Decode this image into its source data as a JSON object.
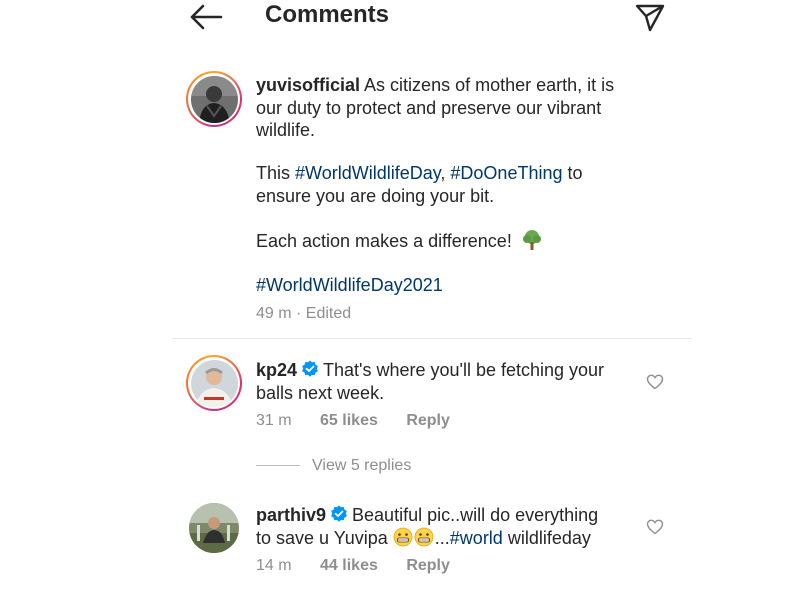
{
  "header": {
    "title": "Comments"
  },
  "caption": {
    "username": "yuvisofficial",
    "line1_text": " As citizens of mother earth, it is",
    "line2": "our duty to protect and preserve our vibrant",
    "line3": "wildlife.",
    "para2_pre": "This ",
    "tag1": "#WorldWildlifeDay",
    "sep": ", ",
    "tag2": "#DoOneThing",
    "para2_post": " to",
    "para2_line2": "ensure you are doing your bit.",
    "para3": "Each action makes a difference!",
    "tag3": "#WorldWildlifeDay2021",
    "meta": "49 m · Edited"
  },
  "comments": [
    {
      "username": "kp24",
      "line1": "That's where you'll be fetching your",
      "line2": "balls next week.",
      "time": "31 m",
      "likes": "65 likes",
      "reply": "Reply",
      "view_replies": "View 5 replies"
    },
    {
      "username": "parthiv9",
      "line1": "Beautiful pic..will do everything",
      "line2_pre": "to save u Yuvipa ",
      "line2_dots": "...",
      "line2_tag": "#world",
      "line2_post": " wildlifeday",
      "time": "14 m",
      "likes": "44 likes",
      "reply": "Reply"
    }
  ],
  "colors": {
    "text": "#262626",
    "meta": "#8e8e8e",
    "hashtag": "#00376b",
    "verified": "#0095f6"
  }
}
